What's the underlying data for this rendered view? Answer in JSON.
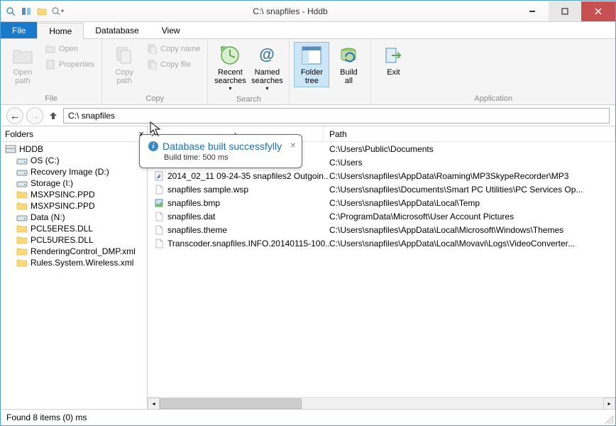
{
  "titlebar": {
    "title": "C:\\ snapfiles - Hddb",
    "qat": [
      "search-icon",
      "panels-icon",
      "folder-icon",
      "zoom-icon"
    ]
  },
  "menu": {
    "file": "File",
    "tabs": [
      "Home",
      "Datatabase",
      "View"
    ],
    "active": 0
  },
  "ribbon": {
    "groups": [
      {
        "label": "File",
        "big": [
          {
            "label": "Open\npath",
            "icon": "folder-path-icon",
            "disabled": true
          }
        ],
        "small": [
          {
            "label": "Open",
            "icon": "folder-open-icon",
            "disabled": true
          },
          {
            "label": "Properties",
            "icon": "properties-icon",
            "disabled": true
          }
        ]
      },
      {
        "label": "Copy",
        "big": [
          {
            "label": "Copy\npath",
            "icon": "copy-path-icon",
            "disabled": true
          }
        ],
        "small": [
          {
            "label": "Copy name",
            "icon": "copy-name-icon",
            "disabled": true
          },
          {
            "label": "Copy file",
            "icon": "copy-file-icon",
            "disabled": true
          }
        ]
      },
      {
        "label": "Search",
        "big": [
          {
            "label": "Recent\nsearches",
            "icon": "recent-searches-icon",
            "arrow": true
          },
          {
            "label": "Named\nsearches",
            "icon": "named-searches-icon",
            "arrow": true
          }
        ]
      },
      {
        "label": "",
        "big": [
          {
            "label": "Folder\ntree",
            "icon": "folder-tree-icon",
            "active": true
          },
          {
            "label": "Build\nall",
            "icon": "build-all-icon"
          }
        ]
      },
      {
        "label": "Application",
        "big": [
          {
            "label": "Exit",
            "icon": "exit-icon"
          }
        ]
      }
    ]
  },
  "address": {
    "value": "C:\\ snapfiles"
  },
  "folders": {
    "header": "Folders",
    "root": "HDDB",
    "items": [
      {
        "label": "OS (C:)",
        "level": 1,
        "icon": "drive-icon"
      },
      {
        "label": "Recovery Image (D:)",
        "level": 1,
        "icon": "drive-icon"
      },
      {
        "label": "Storage (I:)",
        "level": 1,
        "icon": "drive-icon"
      },
      {
        "label": "MSXPSINC.PPD",
        "level": 1,
        "icon": "folder-yellow-icon"
      },
      {
        "label": "MSXPSINC.PPD",
        "level": 1,
        "icon": "folder-yellow-icon"
      },
      {
        "label": "Data (N:)",
        "level": 1,
        "icon": "drive-icon"
      },
      {
        "label": "PCL5ERES.DLL",
        "level": 1,
        "icon": "folder-yellow-icon"
      },
      {
        "label": "PCL5URES.DLL",
        "level": 1,
        "icon": "folder-yellow-icon"
      },
      {
        "label": "RenderingControl_DMP.xml",
        "level": 1,
        "icon": "folder-yellow-icon"
      },
      {
        "label": "Rules.System.Wireless.xml",
        "level": 1,
        "icon": "folder-yellow-icon"
      }
    ]
  },
  "results": {
    "cols": {
      "name": "",
      "path": "Path"
    },
    "rows": [
      {
        "name": "",
        "path": "C:\\Users\\Public\\Documents",
        "icon": "folder-icon"
      },
      {
        "name": "",
        "path": "C:\\Users",
        "icon": "folder-icon"
      },
      {
        "name": "2014_02_11 09-24-35 snapfiles2 Outgoin...",
        "path": "C:\\Users\\snapfiles\\AppData\\Roaming\\MP3SkypeRecorder\\MP3",
        "icon": "audio-icon"
      },
      {
        "name": "snapfiles sample.wsp",
        "path": "C:\\Users\\snapfiles\\Documents\\Smart PC Utilities\\PC Services Op...",
        "icon": "file-icon"
      },
      {
        "name": "snapfiles.bmp",
        "path": "C:\\Users\\snapfiles\\AppData\\Local\\Temp",
        "icon": "image-icon"
      },
      {
        "name": "snapfiles.dat",
        "path": "C:\\ProgramData\\Microsoft\\User Account Pictures",
        "icon": "file-icon"
      },
      {
        "name": "snapfiles.theme",
        "path": "C:\\Users\\snapfiles\\AppData\\Local\\Microsoft\\Windows\\Themes",
        "icon": "file-icon"
      },
      {
        "name": "Transcoder.snapfiles.INFO.20140115-100...",
        "path": "C:\\Users\\snapfiles\\AppData\\Local\\Movavi\\Logs\\VideoConverter...",
        "icon": "file-icon"
      }
    ]
  },
  "toast": {
    "title": "Database built successfylly",
    "sub": "Build time: 500 ms"
  },
  "status": "Found 8 items (0) ms"
}
